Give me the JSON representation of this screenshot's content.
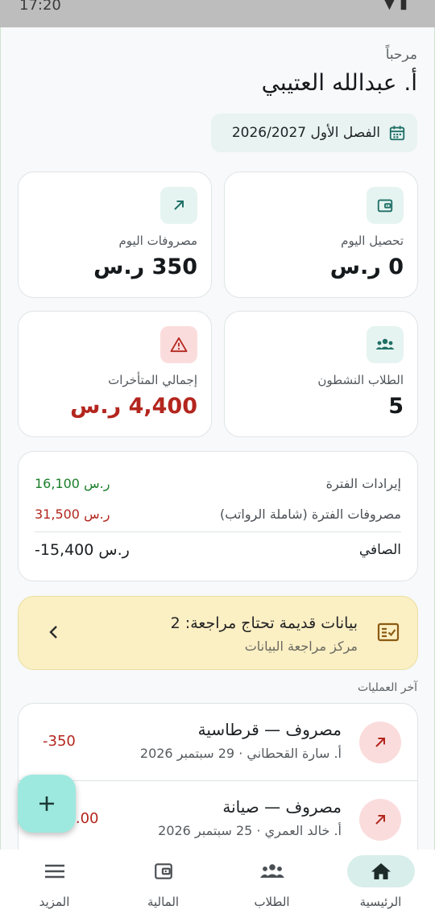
{
  "status_bar": {
    "time": "17:20"
  },
  "header": {
    "greeting": "مرحباً",
    "user_name": "أ. عبدالله العتيبي"
  },
  "term": {
    "label": "الفصل الأول 2026/2027",
    "icon": "calendar-icon"
  },
  "stats": [
    {
      "label": "تحصيل اليوم",
      "value": "0 ر.س",
      "icon": "wallet-icon"
    },
    {
      "label": "مصروفات اليوم",
      "value": "350 ر.س",
      "icon": "arrow-up-right-icon"
    },
    {
      "label": "الطلاب النشطون",
      "value": "5",
      "icon": "group-icon"
    },
    {
      "label": "إجمالي المتأخرات",
      "value": "4,400 ر.س",
      "icon": "warning-icon"
    }
  ],
  "summary": {
    "revenue_label": "إيرادات الفترة",
    "revenue_value": "16,100 ر.س",
    "expenses_label": "مصروفات الفترة (شاملة الرواتب)",
    "expenses_value": "31,500 ر.س",
    "net_label": "الصافي",
    "net_value": "-15,400 ر.س"
  },
  "alert": {
    "title": "بيانات قديمة تحتاج مراجعة: 2",
    "subtitle": "مركز مراجعة البيانات"
  },
  "recent": {
    "title": "آخر العمليات",
    "items": [
      {
        "title": "مصروف — قرطاسية",
        "subtitle": "أ. سارة القحطاني · 29 سبتمبر 2026",
        "amount": "-350"
      },
      {
        "title": "مصروف — صيانة",
        "subtitle": "أ. خالد العمري · 25 سبتمبر 2026",
        "amount": "-200.00"
      }
    ]
  },
  "nav": [
    {
      "label": "الرئيسية",
      "icon": "home-icon",
      "active": true
    },
    {
      "label": "الطلاب",
      "icon": "group-icon",
      "active": false
    },
    {
      "label": "المالية",
      "icon": "wallet-icon",
      "active": false
    },
    {
      "label": "المزيد",
      "icon": "menu-icon",
      "active": false
    }
  ],
  "colors": {
    "accent": "#1f8a7a",
    "danger": "#b3261e",
    "success": "#1b7f2a",
    "alert_bg": "#fbefc4"
  }
}
